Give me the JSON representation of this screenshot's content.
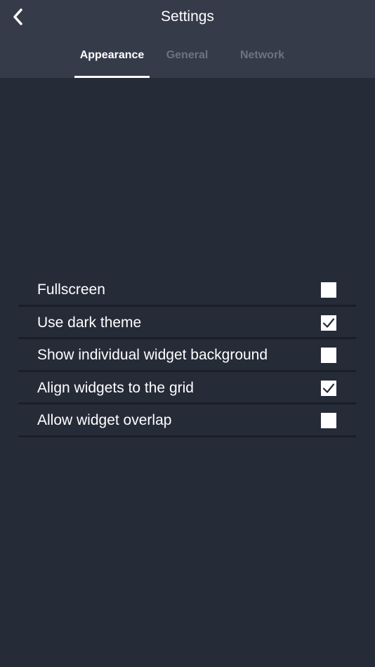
{
  "header": {
    "title": "Settings",
    "back_icon": "chevron-left-icon"
  },
  "tabs": [
    {
      "label": "Appearance",
      "active": true
    },
    {
      "label": "General",
      "active": false
    },
    {
      "label": "Network",
      "active": false
    }
  ],
  "options": [
    {
      "label": "Fullscreen",
      "checked": false
    },
    {
      "label": "Use dark theme",
      "checked": true
    },
    {
      "label": "Show individual widget background",
      "checked": false
    },
    {
      "label": "Align widgets to the grid",
      "checked": true
    },
    {
      "label": "Allow widget overlap",
      "checked": false
    }
  ],
  "colors": {
    "background": "#262b38",
    "header": "#363b4a",
    "active_tab": "#ffffff",
    "inactive_tab": "#6e7380",
    "divider": "#1a1e27"
  }
}
